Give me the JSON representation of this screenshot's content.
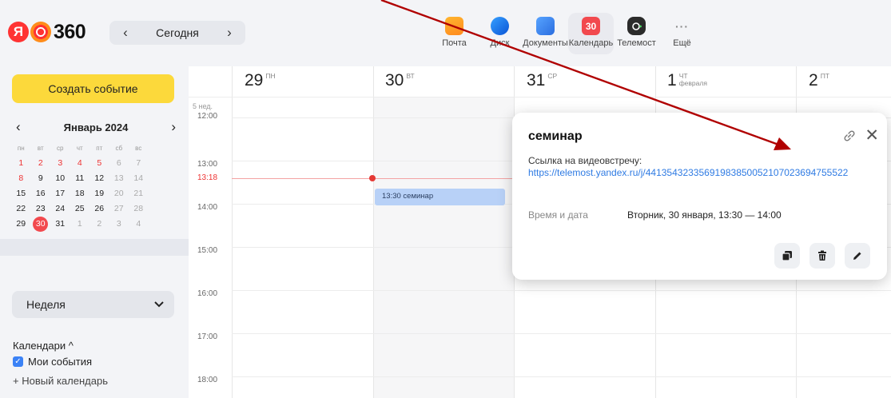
{
  "header": {
    "logo_text": "360",
    "logo_letter": "Я",
    "date_label": "Сегодня",
    "prev_arrow": "‹",
    "next_arrow": "›",
    "apps": [
      {
        "label": "Почта",
        "icon": "mail-icon"
      },
      {
        "label": "Диск",
        "icon": "disk-icon"
      },
      {
        "label": "Документы",
        "icon": "documents-icon"
      },
      {
        "label": "Календарь",
        "icon": "calendar-icon",
        "badge": "30",
        "active": true
      },
      {
        "label": "Телемост",
        "icon": "telemost-icon"
      },
      {
        "label": "Ещё",
        "icon": "more-icon",
        "glyph": "···"
      }
    ]
  },
  "sidebar": {
    "create_button": "Создать событие",
    "minical": {
      "month_label": "Январь 2024",
      "day_names": [
        "пн",
        "вт",
        "ср",
        "чт",
        "пт",
        "сб",
        "вс"
      ],
      "weeks": [
        [
          "1",
          "2",
          "3",
          "4",
          "5",
          "6",
          "7"
        ],
        [
          "8",
          "9",
          "10",
          "11",
          "12",
          "13",
          "14"
        ],
        [
          "15",
          "16",
          "17",
          "18",
          "19",
          "20",
          "21"
        ],
        [
          "22",
          "23",
          "24",
          "25",
          "26",
          "27",
          "28"
        ],
        [
          "29",
          "30",
          "31",
          "1",
          "2",
          "3",
          "4"
        ]
      ],
      "today": "30"
    },
    "view_select": "Неделя",
    "calendars_title": "Календари ^",
    "my_events": "Мои события",
    "new_calendar": "+ Новый календарь"
  },
  "week": {
    "days": [
      {
        "num": "29",
        "wd": "ПН",
        "sub": ""
      },
      {
        "num": "30",
        "wd": "ВТ",
        "sub": ""
      },
      {
        "num": "31",
        "wd": "СР",
        "sub": ""
      },
      {
        "num": "1",
        "wd": "ЧТ",
        "sub": "февраля"
      },
      {
        "num": "2",
        "wd": "ПТ",
        "sub": ""
      }
    ],
    "week_number": "5 нед.",
    "times": [
      "12:00",
      "13:00",
      "14:00",
      "15:00",
      "16:00",
      "17:00",
      "18:00"
    ],
    "now_time": "13:18",
    "event_label": "13:30 семинар"
  },
  "popup": {
    "title": "семинар",
    "link_label": "Ссылка на видеовстречу:",
    "url": "https://telemost.yandex.ru/j/44135432335691983850052107023694755522",
    "time_label": "Время и дата",
    "time_value": "Вторник, 30 января, 13:30 — 14:00"
  },
  "colors": {
    "accent_yellow": "#fcd93b",
    "today_red": "#f2494e",
    "event_blue": "#b8d1f7",
    "link_blue": "#2f7be3",
    "annotation_arrow": "#b00000"
  }
}
